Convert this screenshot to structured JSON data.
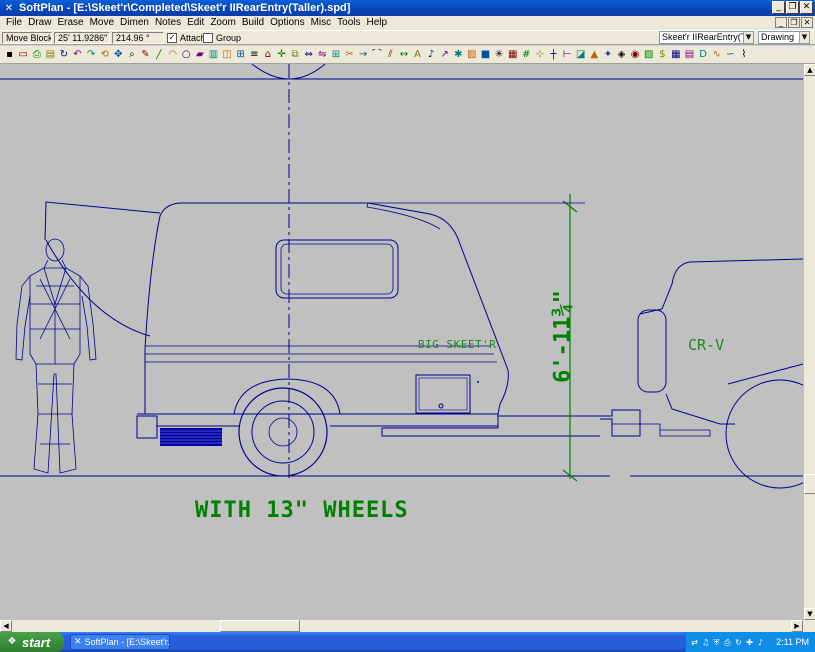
{
  "window": {
    "app_icon": "softplan-app-icon",
    "title": "SoftPlan - [E:\\Skeet'r\\Completed\\Skeet'r IIRearEntry(Taller).spd]",
    "controls": [
      "_",
      "❐",
      "✕"
    ]
  },
  "menu": {
    "items": [
      "File",
      "Draw",
      "Erase",
      "Move",
      "Dimen",
      "Notes",
      "Edit",
      "Zoom",
      "Build",
      "Options",
      "Misc",
      "Tools",
      "Help"
    ],
    "mdi_controls": [
      "_",
      "❐",
      "✕"
    ]
  },
  "options_bar": {
    "mode": "Move Block",
    "distance": "25' 11.9286\"",
    "angle": "214.96 °",
    "attach_label": "Attach",
    "attach_checked": "✓",
    "group_label": "Group",
    "group_checked": "",
    "layer_select": "Skeet'r IIRearEntry(Taller)",
    "view_select": "Drawing"
  },
  "toolbar": {
    "icons": [
      "save-icon",
      "open-icon",
      "print-icon",
      "print-preview-icon",
      "redraw-icon",
      "undo-icon",
      "redo-icon",
      "rotate-icon",
      "pan-icon",
      "zoom-icon",
      "pencil-icon",
      "line-icon",
      "arc-icon",
      "circle-icon",
      "paint-icon",
      "wall-icon",
      "door-icon",
      "window-icon",
      "stair-icon",
      "roof-icon",
      "move-icon",
      "copy-icon",
      "stretch-icon",
      "mirror-icon",
      "array-icon",
      "trim-icon",
      "extend-icon",
      "fillet-icon",
      "offset-icon",
      "dimension-icon",
      "text-icon",
      "note-icon",
      "leader-icon",
      "symbol-icon",
      "hatch-icon",
      "block-icon",
      "explode-icon",
      "layer-icon",
      "grid-icon",
      "snap-icon",
      "ortho-icon",
      "measure-icon",
      "area-icon",
      "elevation-icon",
      "section-icon",
      "3d-icon",
      "render-icon",
      "materials-icon",
      "estimate-icon",
      "table-icon",
      "report-icon",
      "d-icon",
      "curve-icon",
      "spline-icon",
      "brush-icon"
    ]
  },
  "drawing": {
    "trailer_label": "BIG SKEET'R",
    "vehicle_label": "CR-V",
    "height_dimension": "6'-11¾\"",
    "caption": "WITH 13\" WHEELS",
    "line_color": "#00008b",
    "dim_color": "#008000",
    "text_color": "#1a8a1a"
  },
  "taskbar": {
    "start_label": "start",
    "task_label": "SoftPlan - [E:\\Skeet'r...",
    "tray_icons": [
      "network-icon",
      "volume-icon",
      "shield-icon",
      "printer-icon",
      "update-icon",
      "antivirus-icon",
      "speaker-icon"
    ],
    "clock": "2:11 PM"
  }
}
